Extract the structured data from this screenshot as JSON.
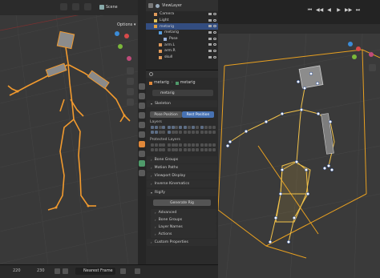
{
  "left_viewport": {
    "options_label": "Options",
    "bottom_numbers": [
      "220",
      "230"
    ],
    "playback_mode": "Nearest Frame"
  },
  "header": {
    "scene_label": "Scene",
    "view_layer_label": "ViewLayer"
  },
  "outliner": {
    "rows": [
      {
        "label": "Camera",
        "indent": 1,
        "icon_color": "#e19a5a",
        "selected": false
      },
      {
        "label": "Light",
        "indent": 1,
        "icon_color": "#e1c25a",
        "selected": false
      },
      {
        "label": "metarig",
        "indent": 1,
        "icon_color": "#e1a040",
        "selected": true
      },
      {
        "label": "metarig",
        "indent": 2,
        "icon_color": "#5aa0e1",
        "selected": false
      },
      {
        "label": "Pose",
        "indent": 3,
        "icon_color": "#9bb1d8",
        "selected": false
      },
      {
        "label": "arm.L",
        "indent": 2,
        "icon_color": "#e19a5a",
        "selected": false
      },
      {
        "label": "arm.R",
        "indent": 2,
        "icon_color": "#e19a5a",
        "selected": false
      },
      {
        "label": "skull",
        "indent": 2,
        "icon_color": "#e19a5a",
        "selected": false
      }
    ]
  },
  "properties": {
    "breadcrumb": [
      "metarig",
      "metarig"
    ],
    "name_field": "metarig",
    "sections": {
      "skeleton": "Skeleton",
      "pose_position": "Pose Position",
      "rest_position": "Rest Position",
      "layers": "Layers",
      "protected_layers": "Protected Layers",
      "bone_groups": "Bone Groups",
      "motion_paths": "Motion Paths",
      "viewport_display": "Viewport Display",
      "inverse_kinematics": "Inverse Kinematics",
      "rigify": "Rigify",
      "generate_rig": "Generate Rig",
      "advanced": "Advanced",
      "rigify_bone_groups": "Bone Groups",
      "layer_names": "Layer Names",
      "actions": "Actions",
      "custom_properties": "Custom Properties"
    }
  },
  "right_viewport": {
    "playback_icons": [
      "⏮",
      "◀◀",
      "◀",
      "▶",
      "▶▶",
      "⏭"
    ]
  },
  "colors": {
    "bone_orange": "#f29a2e",
    "selected_blue": "#4772b3",
    "bbox_yellow": "#e8a020"
  }
}
